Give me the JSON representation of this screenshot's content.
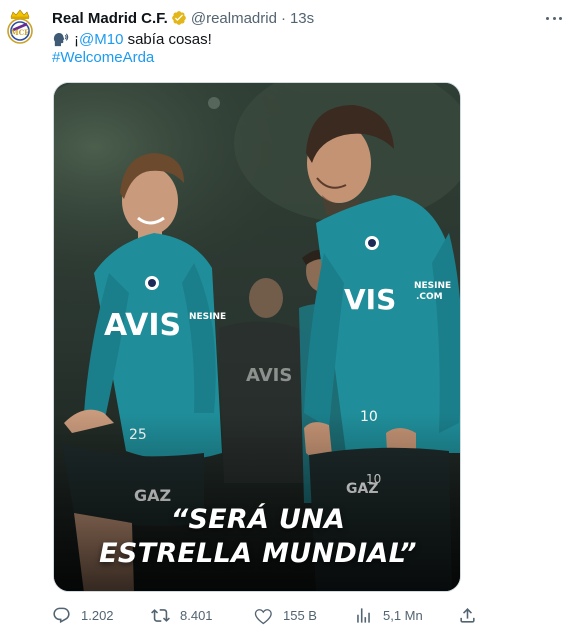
{
  "tweet": {
    "author_name": "Real Madrid C.F.",
    "handle": "@realmadrid",
    "separator": "·",
    "time": "13s",
    "text_prefix": "¡",
    "mention": "@M10",
    "text_rest": " sabía cosas!",
    "hashtag": "#WelcomeArda",
    "image_caption_line1": "“SERÁ UNA",
    "image_caption_line2": "ESTRELLA MUNDIAL”"
  },
  "actions": {
    "replies": "1.202",
    "reposts": "8.401",
    "likes": "155 B",
    "views": "5,1 Mn"
  },
  "icons": {
    "avatar": "real-madrid-crest-icon",
    "verified": "gold-verified-badge-icon",
    "speaking": "speaking-head-icon",
    "more": "more-horizontal-icon",
    "reply": "reply-icon",
    "repost": "repost-icon",
    "like": "heart-icon",
    "views": "bar-chart-icon",
    "share": "share-icon"
  },
  "colors": {
    "text": "#0f1419",
    "secondary": "#536471",
    "link": "#1d9bf0",
    "verified_gold": "#e2b719",
    "jersey_teal": "#1f8e9a"
  }
}
